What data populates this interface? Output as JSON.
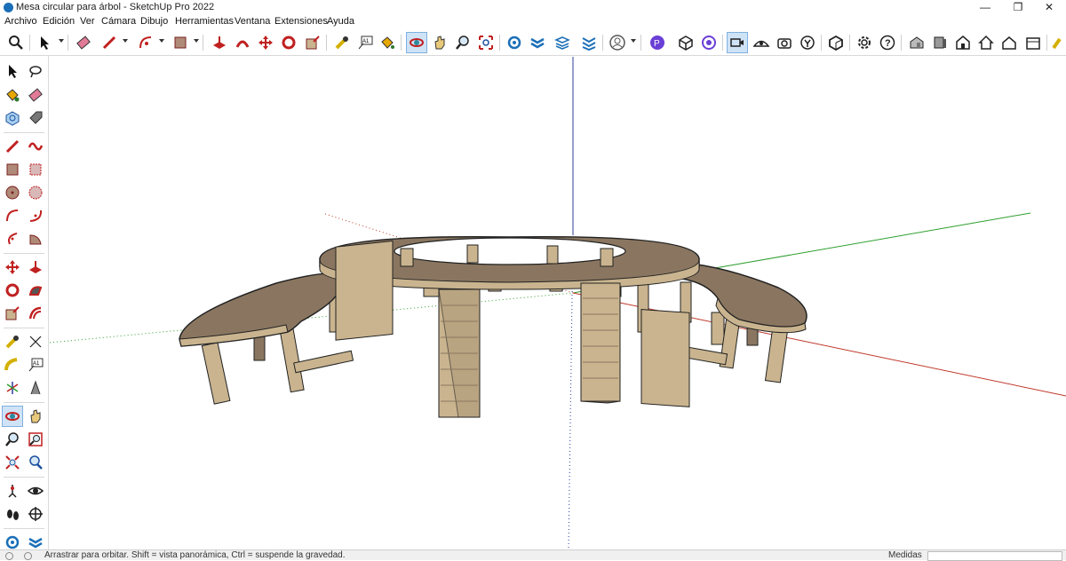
{
  "window": {
    "title": "Mesa circular para árbol - SketchUp Pro 2022",
    "controls": {
      "minimize": "—",
      "maximize": "❐",
      "close": "✕"
    }
  },
  "menubar": {
    "items": [
      "Archivo",
      "Edición",
      "Ver",
      "Cámara",
      "Dibujo",
      "Herramientas",
      "Ventana",
      "Extensiones",
      "Ayuda"
    ]
  },
  "toolbar": {
    "icons": [
      "zoom-extents-icon",
      "select-icon",
      "eraser-icon",
      "pencil-line-icon",
      "arc-icon",
      "rectangle-icon",
      "push-pull-icon",
      "follow-me-icon",
      "move-icon",
      "rotate-icon",
      "scale-icon",
      "tape-measure-icon",
      "text-icon",
      "paint-bucket-icon",
      "orbit-icon",
      "pan-icon",
      "zoom-icon",
      "zoom-window-icon",
      "components-icon",
      "sandbox-icon",
      "layers-icon",
      "styles-icon",
      "account-icon",
      "extension-icon",
      "3d-warehouse-icon",
      "scenes-icon",
      "camera-icon",
      "position-camera-icon",
      "look-around-icon",
      "walk-icon",
      "solid-tools-icon",
      "settings-icon",
      "help-icon",
      "iso-view-icon",
      "front-view-icon",
      "top-view-icon",
      "home-view-icon",
      "right-view-icon",
      "back-view-icon",
      "section-plane-icon"
    ]
  },
  "colors": {
    "axis_red": "#c0392b",
    "axis_green": "#2e9e2e",
    "axis_blue": "#2c3e9e",
    "wood_light": "#c9b48f",
    "wood_dark": "#8a7660",
    "active_bg": "#cfe3f7"
  },
  "status": {
    "hint": "Arrastrar para orbitar. Shift = vista panorámica, Ctrl = suspende la gravedad.",
    "measure_label": "Medidas",
    "measure_value": ""
  }
}
